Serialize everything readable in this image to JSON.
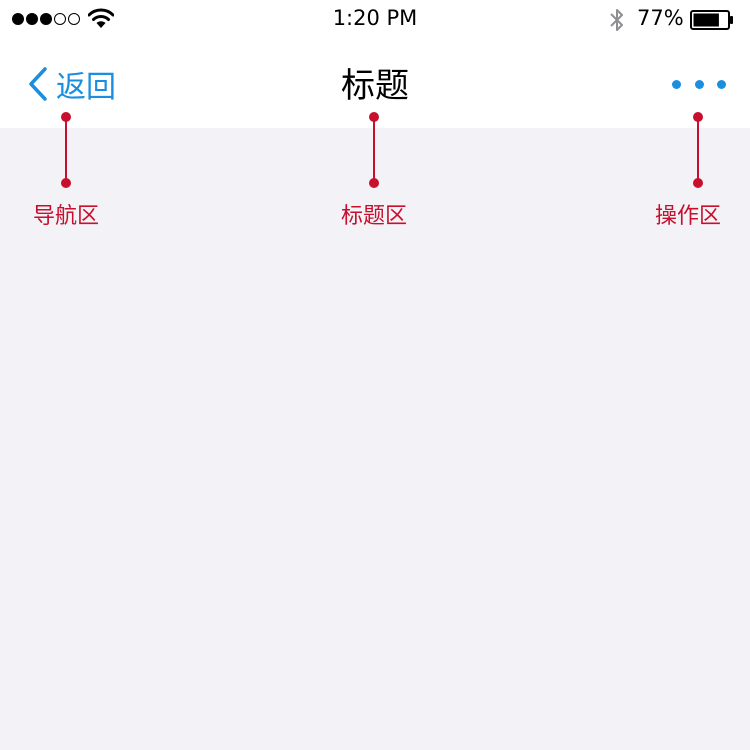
{
  "status_bar": {
    "time": "1:20 PM",
    "battery_percent": "77%",
    "signal_bars_on": 3,
    "signal_bars_total": 5,
    "battery_level": 0.77
  },
  "nav_bar": {
    "back_label": "返回",
    "title": "标题",
    "more_icon": "ellipsis-icon"
  },
  "annotations": {
    "navigation": "导航区",
    "title": "标题区",
    "actions": "操作区"
  },
  "colors": {
    "accent": "#1a8fe0",
    "annotation": "#c8102e",
    "content_background": "#f2f2f7"
  }
}
